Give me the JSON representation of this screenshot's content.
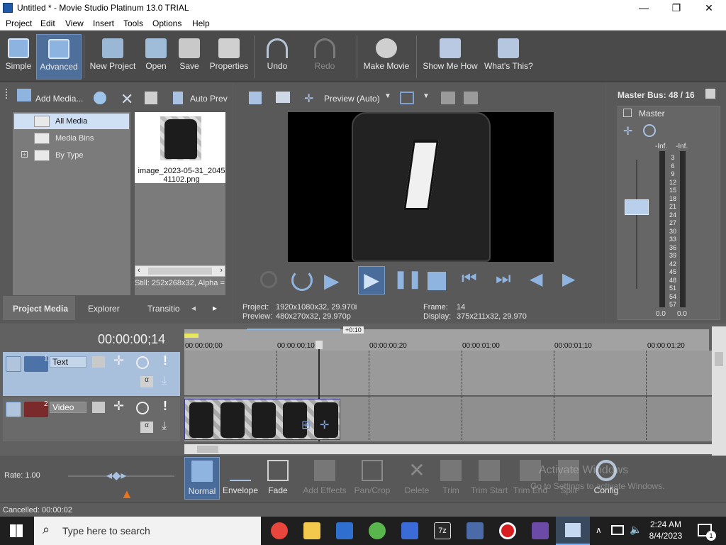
{
  "window": {
    "title": "Untitled * - Movie Studio Platinum 13.0 TRIAL",
    "controls": [
      "—",
      "❐",
      "✕"
    ]
  },
  "menu": [
    "Project",
    "Edit",
    "View",
    "Insert",
    "Tools",
    "Options",
    "Help"
  ],
  "toolbar": {
    "simple": "Simple",
    "advanced": "Advanced",
    "new_project": "New Project",
    "open": "Open",
    "save": "Save",
    "properties": "Properties",
    "undo": "Undo",
    "redo": "Redo",
    "make_movie": "Make Movie",
    "show_me_how": "Show Me How",
    "whats_this": "What's This?"
  },
  "media": {
    "add_media": "Add Media...",
    "auto_preview": "Auto Prev",
    "tree": [
      "All Media",
      "Media Bins",
      "By Type"
    ],
    "file_name_line1": "image_2023-05-31_2045",
    "file_name_line2": "41102.png",
    "status": "Still: 252x268x32, Alpha =",
    "tabs": [
      "Project Media",
      "Explorer",
      "Transitio"
    ]
  },
  "preview": {
    "mode": "Preview (Auto)",
    "project_label": "Project:",
    "project_value": "1920x1080x32, 29.970i",
    "preview_label": "Preview:",
    "preview_value": "480x270x32, 29.970p",
    "frame_label": "Frame:",
    "frame_value": "14",
    "display_label": "Display:",
    "display_value": "375x211x32, 29.970"
  },
  "master": {
    "title": "Master Bus: 48 / 16",
    "name": "Master",
    "left_peak": "-Inf.",
    "right_peak": "-Inf.",
    "scale": [
      "3",
      "6",
      "9",
      "12",
      "15",
      "18",
      "21",
      "24",
      "27",
      "30",
      "33",
      "36",
      "39",
      "42",
      "45",
      "48",
      "51",
      "54",
      "57"
    ],
    "left_value": "0.0",
    "right_value": "0.0"
  },
  "timeline": {
    "timecode": "00:00:00;14",
    "offset": "+0:10",
    "ruler": [
      "00:00:00;00",
      "00:00:00;10",
      "00:00:00;20",
      "00:00:01;00",
      "00:00:01;10",
      "00:00:01;20"
    ],
    "tracks": [
      {
        "number": "1",
        "name": "Text"
      },
      {
        "number": "2",
        "name": "Video"
      }
    ]
  },
  "bottom": {
    "rate": "Rate: 1.00",
    "tools": [
      "Normal",
      "Envelope",
      "Fade",
      "Add Effects",
      "Pan/Crop",
      "Delete",
      "Trim",
      "Trim Start",
      "Trim End",
      "Split",
      "Config"
    ],
    "status": "Cancelled: 00:00:02",
    "watermark1": "Activate Windows",
    "watermark2": "Go to Settings to activate Windows."
  },
  "taskbar": {
    "search_placeholder": "Type here to search",
    "time": "2:24 AM",
    "date": "8/4/2023",
    "notification_count": "1"
  },
  "colors": {
    "accent": "#4e6f99",
    "panel": "#595959",
    "tree_selected": "#cfe0f5",
    "text_track": "#4d72a8",
    "video_track": "#7a2a2a"
  }
}
